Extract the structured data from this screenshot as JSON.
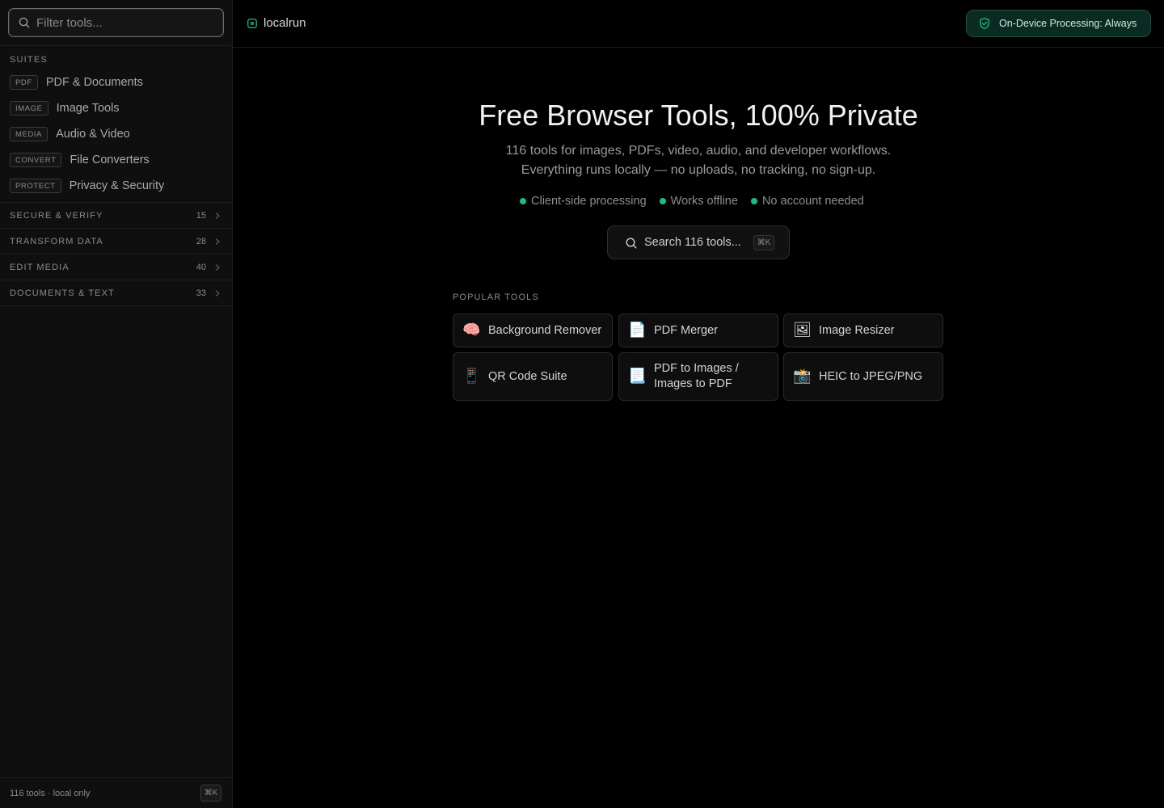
{
  "sidebar": {
    "filter_placeholder": "Filter tools...",
    "suites_heading": "SUITES",
    "suites": [
      {
        "tag": "PDF",
        "label": "PDF & Documents"
      },
      {
        "tag": "IMAGE",
        "label": "Image Tools"
      },
      {
        "tag": "MEDIA",
        "label": "Audio & Video"
      },
      {
        "tag": "CONVERT",
        "label": "File Converters"
      },
      {
        "tag": "PROTECT",
        "label": "Privacy & Security"
      }
    ],
    "groups": [
      {
        "label": "SECURE & VERIFY",
        "count": "15"
      },
      {
        "label": "TRANSFORM DATA",
        "count": "28"
      },
      {
        "label": "EDIT MEDIA",
        "count": "40"
      },
      {
        "label": "DOCUMENTS & TEXT",
        "count": "33"
      }
    ],
    "footer_text": "116 tools · local only",
    "footer_shortcut": "⌘K"
  },
  "header": {
    "brand": "localrun",
    "privacy_badge": "On-Device Processing: Always"
  },
  "hero": {
    "title": "Free Browser Tools, 100% Private",
    "subtitle_line1": "116 tools for images, PDFs, video, audio, and developer workflows.",
    "subtitle_line2": "Everything runs locally — no uploads, no tracking, no sign-up.",
    "features": [
      "Client-side processing",
      "Works offline",
      "No account needed"
    ],
    "search_label": "Search 116 tools...",
    "search_shortcut": "⌘K"
  },
  "popular": {
    "heading": "POPULAR TOOLS",
    "tools": [
      {
        "icon": "brain-icon",
        "emoji": "🧠",
        "label": "Background Remover"
      },
      {
        "icon": "document-icon",
        "emoji": "📄",
        "label": "PDF Merger"
      },
      {
        "icon": "picture-icon",
        "emoji": "🖼",
        "label": "Image Resizer"
      },
      {
        "icon": "phone-icon",
        "emoji": "📱",
        "label": "QR Code Suite"
      },
      {
        "icon": "page-icon",
        "emoji": "📃",
        "label": "PDF to Images / Images to PDF"
      },
      {
        "icon": "camera-flash-icon",
        "emoji": "📸",
        "label": "HEIC to JPEG/PNG"
      }
    ]
  },
  "colors": {
    "accent_green": "#19c07d",
    "badge_bg": "#0b2a21",
    "background": "#000000",
    "sidebar_bg": "#0f0f0f"
  }
}
